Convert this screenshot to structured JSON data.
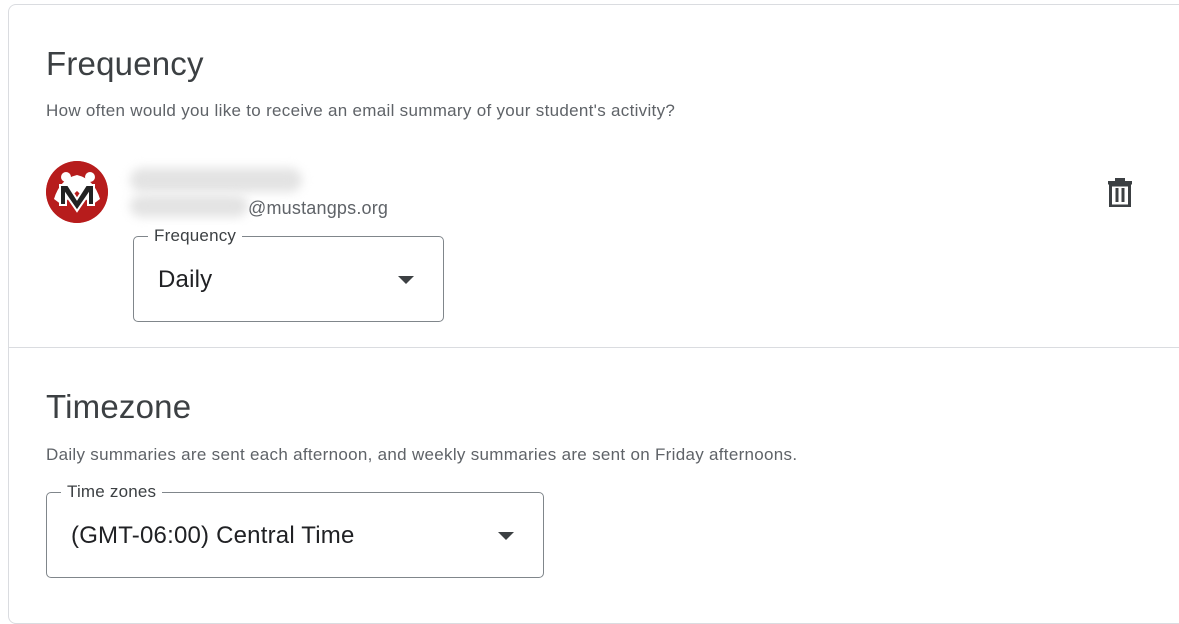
{
  "frequency_section": {
    "title": "Frequency",
    "description": "How often would you like to receive an email summary of your student's activity?",
    "guardian": {
      "email_domain": "@mustangps.org"
    },
    "frequency_select": {
      "label": "Frequency",
      "value": "Daily"
    }
  },
  "timezone_section": {
    "title": "Timezone",
    "description": "Daily summaries are sent each afternoon, and weekly summaries are sent on Friday afternoons.",
    "timezone_select": {
      "label": "Time zones",
      "value": "(GMT-06:00) Central Time"
    }
  },
  "colors": {
    "border": "#dadce0",
    "avatar_red": "#c62828",
    "text_primary": "#202124",
    "text_secondary": "#5f6368"
  },
  "icons": {
    "delete": "trash-icon",
    "dropdown": "dropdown-arrow-icon",
    "avatar": "mustang-logo"
  }
}
